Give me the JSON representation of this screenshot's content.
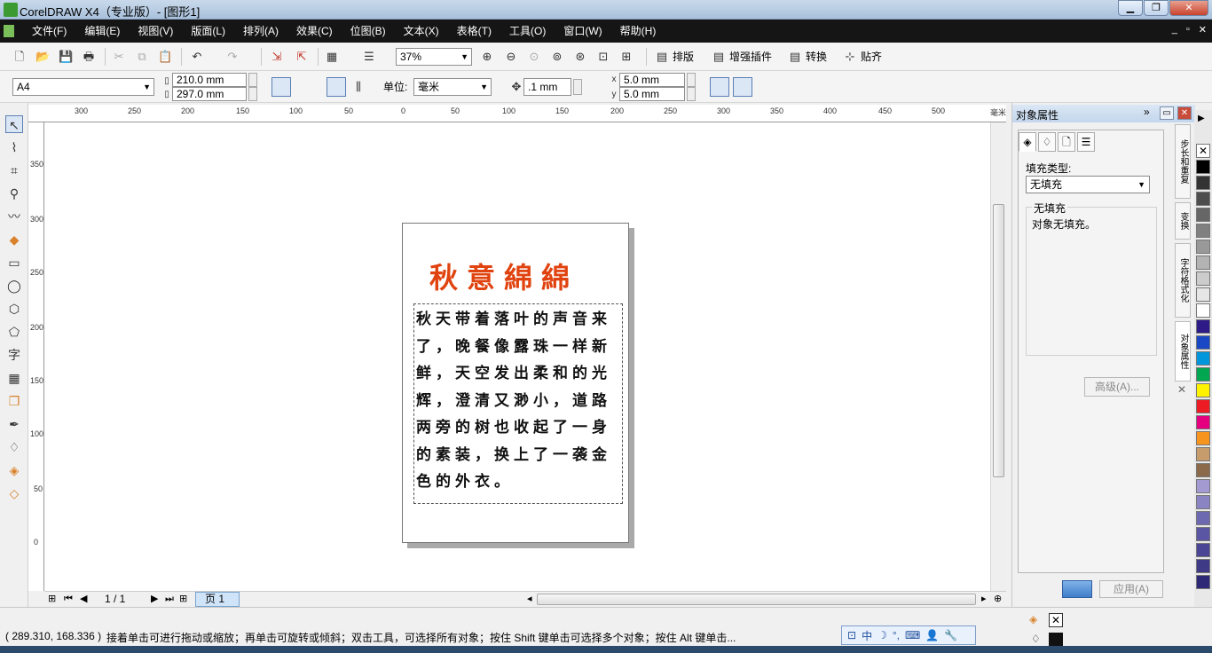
{
  "titlebar": {
    "title": "CorelDRAW X4（专业版）- [图形1]",
    "min": "▁",
    "max": "❐",
    "close": "✕"
  },
  "menu": {
    "items": [
      "文件(F)",
      "编辑(E)",
      "视图(V)",
      "版面(L)",
      "排列(A)",
      "效果(C)",
      "位图(B)",
      "文本(X)",
      "表格(T)",
      "工具(O)",
      "窗口(W)",
      "帮助(H)"
    ],
    "mdi_min": "_",
    "mdi_restore": "▫",
    "mdi_close": "✕"
  },
  "standard_toolbar": {
    "zoom_value": "37%",
    "layout_label": "排版",
    "plugin_label": "增强插件",
    "convert_label": "转换",
    "snap_label": "贴齐"
  },
  "property_bar": {
    "paper_size": "A4",
    "width": "210.0 mm",
    "height": "297.0 mm",
    "unit_label": "单位:",
    "unit_value": "毫米",
    "nudge": ".1 mm",
    "dup_x": "5.0 mm",
    "dup_y": "5.0 mm",
    "x_label": "x",
    "y_label": "y"
  },
  "rulers": {
    "top_ticks": [
      "300",
      "250",
      "200",
      "150",
      "100",
      "50",
      "0",
      "50",
      "100",
      "150",
      "200",
      "250",
      "300",
      "350",
      "400",
      "450",
      "500"
    ],
    "top_unit": "毫米",
    "left_ticks": [
      "350",
      "300",
      "250",
      "200",
      "150",
      "100",
      "50",
      "0"
    ]
  },
  "document": {
    "title": "秋意綿綿",
    "body": "秋天带着落叶的声音来了，晚餐像露珠一样新鲜，天空发出柔和的光辉，澄清又渺小，道路两旁的树也收起了一身的素装，换上了一袭金色的外衣。"
  },
  "pagebar": {
    "page_count": "1 / 1",
    "page_tab": "页 1"
  },
  "docker": {
    "title": "对象属性",
    "fill_type_label": "填充类型:",
    "fill_type_value": "无填充",
    "group_title": "无填充",
    "group_desc": "对象无填充。",
    "advanced_button": "高级(A)...",
    "apply_button": "应用(A)",
    "vtabs": [
      "步长和重复",
      "变换",
      "字符格式化",
      "对象属性"
    ]
  },
  "palette": {
    "colors": [
      "#000000",
      "#333333",
      "#4d4d4d",
      "#666666",
      "#808080",
      "#999999",
      "#b3b3b3",
      "#cccccc",
      "#e6e6e6",
      "#ffffff",
      "#2e1b87",
      "#1a48c4",
      "#0096dc",
      "#00a650",
      "#fff200",
      "#ed1c24",
      "#e4007f",
      "#f7941d",
      "#c69c6d",
      "#8b6a4c",
      "#a39ad1",
      "#8a84c2",
      "#6c69b0",
      "#5b56a3",
      "#4a4594",
      "#3e3a85",
      "#2d2976"
    ]
  },
  "status": {
    "coords": "( 289.310, 168.336 )",
    "hint": "接着单击可进行拖动或缩放；再单击可旋转或倾斜；双击工具，可选择所有对象；按住 Shift 键单击可选择多个对象；按住 Alt 键单击...",
    "ime_mode": "中"
  }
}
